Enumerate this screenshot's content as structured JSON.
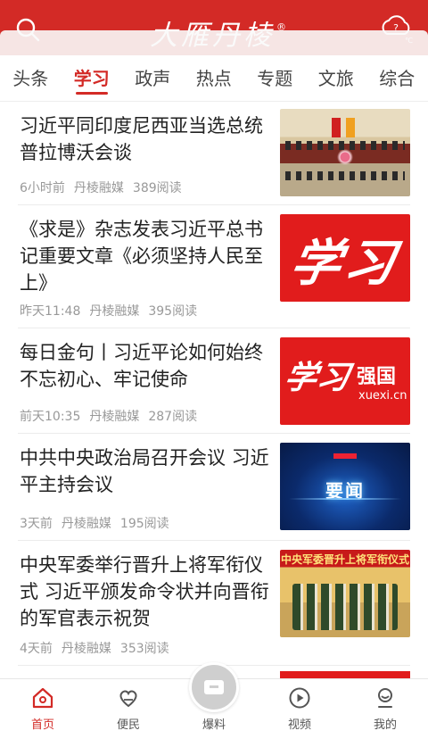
{
  "header": {
    "logo": "大雁丹棱",
    "registered": "®"
  },
  "tabs": [
    {
      "label": "头条",
      "active": false
    },
    {
      "label": "学习",
      "active": true
    },
    {
      "label": "政声",
      "active": false
    },
    {
      "label": "热点",
      "active": false
    },
    {
      "label": "专题",
      "active": false
    },
    {
      "label": "文旅",
      "active": false
    },
    {
      "label": "综合",
      "active": false
    }
  ],
  "articles": [
    {
      "title": "习近平同印度尼西亚当选总统普拉博沃会谈",
      "time": "6小时前",
      "source": "丹棱融媒",
      "reads": "389阅读",
      "image": "meeting-photo"
    },
    {
      "title": "《求是》杂志发表习近平总书记重要文章《必须坚持人民至上》",
      "time": "昨天11:48",
      "source": "丹棱融媒",
      "reads": "395阅读",
      "image": "xuexi-calligraphy",
      "image_text": "学习"
    },
    {
      "title": "每日金句丨习近平论如何始终不忘初心、牢记使命",
      "time": "前天10:35",
      "source": "丹棱融媒",
      "reads": "287阅读",
      "image": "xuexi-qiangguo-logo",
      "image_text": "学习",
      "image_text2": "强国",
      "image_site": "xuexi.cn"
    },
    {
      "title": "中共中央政治局召开会议 习近平主持会议",
      "time": "3天前",
      "source": "丹棱融媒",
      "reads": "195阅读",
      "image": "yaowen-banner",
      "image_text": "要闻"
    },
    {
      "title": "中央军委举行晋升上将军衔仪式 习近平颁发命令状并向晋衔的军官表示祝贺",
      "time": "4天前",
      "source": "丹棱融媒",
      "reads": "353阅读",
      "image": "military-ceremony",
      "image_text": "中央军委晋升上将军衔仪式"
    }
  ],
  "bottom_nav": [
    {
      "label": "首页",
      "icon": "home-icon",
      "active": true
    },
    {
      "label": "便民",
      "icon": "heart-hands-icon",
      "active": false
    },
    {
      "label": "爆料",
      "icon": "inbox-icon",
      "active": false
    },
    {
      "label": "视频",
      "icon": "play-circle-icon",
      "active": false
    },
    {
      "label": "我的",
      "icon": "user-icon",
      "active": false
    }
  ],
  "colors": {
    "brand": "#d32a26",
    "text": "#222222",
    "meta": "#999999"
  }
}
